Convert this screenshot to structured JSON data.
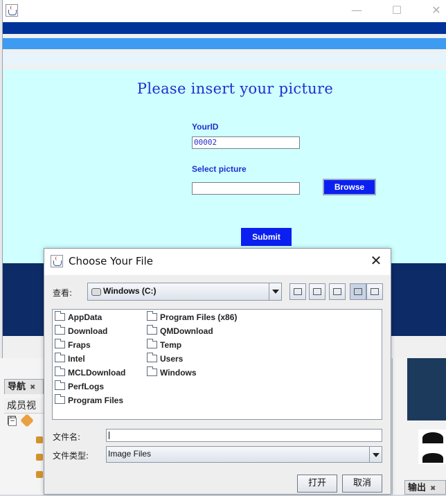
{
  "main_window": {
    "headline": "Please insert your picture",
    "id_label": "YourID",
    "id_value": "00002",
    "picture_label": "Select picture",
    "picture_value": "",
    "browse_label": "Browse",
    "submit_label": "Submit",
    "colors": {
      "content_bg": "#cfffff",
      "accent": "#1f2fcf",
      "button": "#0a1ff0",
      "band_dark": "#003399",
      "band_light": "#3d9bf2",
      "footer": "#0d2b66"
    }
  },
  "background_ide": {
    "nav_tab_label": "导航",
    "member_view_label": "成员视图",
    "output_tab_label": "输出",
    "tab_close_glyph": "✖"
  },
  "dialog": {
    "title": "Choose Your File",
    "look_in_label": "查看:",
    "look_in_value": "Windows (C:)",
    "toolbar_icons": [
      "up-folder-icon",
      "home-icon",
      "new-folder-icon",
      "list-view-icon",
      "details-view-icon"
    ],
    "files_col1": [
      "AppData",
      "Download",
      "Fraps",
      "Intel",
      "MCLDownload",
      "PerfLogs",
      "Program Files"
    ],
    "files_col2": [
      "Program Files (x86)",
      "QMDownload",
      "Temp",
      "Users",
      "Windows"
    ],
    "file_name_label": "文件名:",
    "file_name_value": "",
    "file_type_label": "文件类型:",
    "file_type_value": "Image Files",
    "open_label": "打开",
    "cancel_label": "取消"
  }
}
